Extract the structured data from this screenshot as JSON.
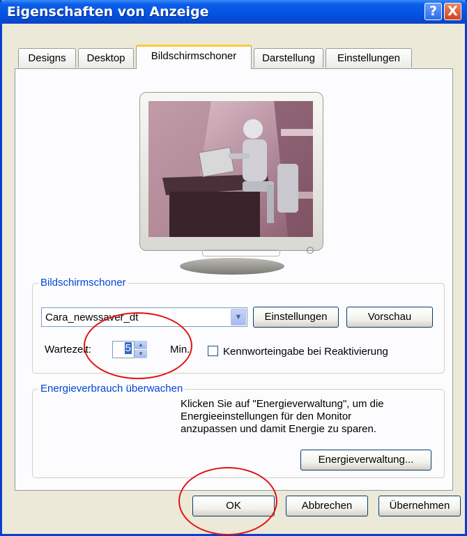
{
  "window": {
    "title": "Eigenschaften von Anzeige",
    "help_label": "?",
    "close_label": "X"
  },
  "tabs": [
    {
      "label": "Designs",
      "active": false
    },
    {
      "label": "Desktop",
      "active": false
    },
    {
      "label": "Bildschirmschoner",
      "active": true
    },
    {
      "label": "Darstellung",
      "active": false
    },
    {
      "label": "Einstellungen",
      "active": false
    }
  ],
  "screensaver": {
    "legend": "Bildschirmschoner",
    "selected": "Cara_newssaver_dt",
    "settings_button": "Einstellungen",
    "preview_button": "Vorschau",
    "wait_label": "Wartezeit:",
    "wait_value": "5",
    "wait_unit": "Min.",
    "password_label": "Kennworteingabe bei Reaktivierung",
    "password_checked": false
  },
  "energy": {
    "legend": "Energieverbrauch überwachen",
    "text_lines": [
      "Klicken Sie auf \"Energieverwaltung\", um die",
      "Energieeinstellungen für den Monitor",
      "anzupassen und damit Energie zu sparen."
    ],
    "button": "Energieverwaltung..."
  },
  "footer": {
    "ok": "OK",
    "cancel": "Abbrechen",
    "apply": "Übernehmen"
  },
  "colors": {
    "titlebar": "#0452e3",
    "group_legend": "#0046d5",
    "annotation": "#e31212",
    "active_tab_accent": "#ffc73c"
  }
}
